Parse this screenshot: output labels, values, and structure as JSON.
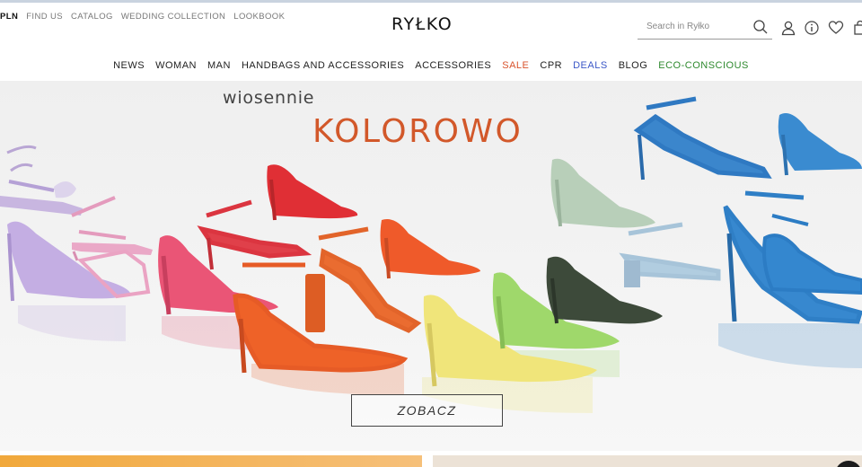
{
  "header": {
    "util_nav": {
      "currency": "PLN",
      "find_us": "FIND US",
      "catalog": "CATALOG",
      "wedding": "WEDDING COLLECTION",
      "lookbook": "LOOKBOOK"
    },
    "logo": "RYŁKO",
    "search": {
      "placeholder": "Search in Ryłko",
      "value": ""
    },
    "icons": [
      "search-icon",
      "user-icon",
      "info-icon",
      "heart-icon",
      "bag-icon"
    ]
  },
  "main_nav": {
    "news": "NEWS",
    "woman": "WOMAN",
    "man": "MAN",
    "handbags": "HANDBAGS AND ACCESSORIES",
    "accessories": "ACCESSORIES",
    "sale": "SALE",
    "cpr": "CPR",
    "deals": "DEALS",
    "blog": "BLOG",
    "eco": "ECO-CONSCIOUS"
  },
  "colors": {
    "accent_orange": "#d2582a",
    "sale": "#d9532c",
    "deals": "#3b57c7",
    "eco": "#2f8a2f"
  },
  "hero": {
    "subtitle": "wiosennie",
    "title": "KOLOROWO",
    "cta": "ZOBACZ"
  }
}
